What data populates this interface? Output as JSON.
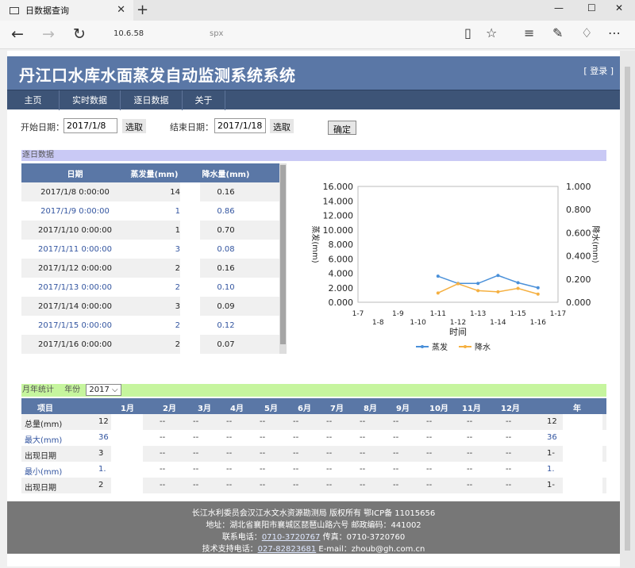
{
  "browser": {
    "tab_title": "日数据查询",
    "url_host": "10.6.58",
    "url_suffix": "spx"
  },
  "header": {
    "title": "丹江口水库水面蒸发自动监测系统系统",
    "login": "[ 登录 ]"
  },
  "menu": [
    "主页",
    "实时数据",
    "逐日数据",
    "关于"
  ],
  "query": {
    "start_label": "开始日期：",
    "start_value": "2017/1/8",
    "end_label": "结束日期：",
    "end_value": "2017/1/18",
    "pick_label": "选取",
    "ok_label": "确定"
  },
  "daily": {
    "section_title": "逐日数据",
    "headers": [
      "日期",
      "蒸发量(mm)",
      "降水量(mm)"
    ],
    "rows": [
      [
        "2017/1/8 0:00:00",
        "14",
        "0.16"
      ],
      [
        "2017/1/9 0:00:00",
        "1",
        "0.86"
      ],
      [
        "2017/1/10 0:00:00",
        "1",
        "0.70"
      ],
      [
        "2017/1/11 0:00:00",
        "3",
        "0.08"
      ],
      [
        "2017/1/12 0:00:00",
        "2",
        "0.16"
      ],
      [
        "2017/1/13 0:00:00",
        "2",
        "0.10"
      ],
      [
        "2017/1/14 0:00:00",
        "3",
        "0.09"
      ],
      [
        "2017/1/15 0:00:00",
        "2",
        "0.12"
      ],
      [
        "2017/1/16 0:00:00",
        "2",
        "0.07"
      ]
    ]
  },
  "chart_data": {
    "type": "line",
    "x_ticks_top": [
      "1-7",
      "1-9",
      "1-11",
      "1-13",
      "1-15",
      "1-17"
    ],
    "x_ticks_bottom": [
      "1-8",
      "1-10",
      "1-12",
      "1-14",
      "1-16"
    ],
    "xlabel": "时间",
    "ylabel_left": "蒸发(mm)",
    "ylabel_right": "降水(mm)",
    "y_left_ticks": [
      "16.000",
      "14.000",
      "12.000",
      "10.000",
      "8.000",
      "6.000",
      "4.000",
      "2.000",
      "0.000"
    ],
    "y_right_ticks": [
      "1.000",
      "0.800",
      "0.600",
      "0.400",
      "0.200",
      "0.000"
    ],
    "ylim_left": [
      0,
      16
    ],
    "ylim_right": [
      0,
      1
    ],
    "series": [
      {
        "name": "蒸发",
        "color": "#4a90d9",
        "x": [
          "1-11",
          "1-12",
          "1-13",
          "1-14",
          "1-15",
          "1-16"
        ],
        "values": [
          3.6,
          2.6,
          2.6,
          3.7,
          2.7,
          2.0
        ]
      },
      {
        "name": "降水",
        "color": "#f5b041",
        "x": [
          "1-11",
          "1-12",
          "1-13",
          "1-14",
          "1-15",
          "1-16"
        ],
        "values": [
          0.08,
          0.16,
          0.1,
          0.09,
          0.12,
          0.07
        ]
      }
    ]
  },
  "monthly": {
    "section_title": "月年统计",
    "year_label": "年份",
    "year_value": "2017",
    "headers": [
      "项目",
      "1月",
      "2月",
      "3月",
      "4月",
      "5月",
      "6月",
      "7月",
      "8月",
      "9月",
      "10月",
      "11月",
      "12月",
      "年"
    ],
    "rows": [
      [
        "总量(mm)",
        "12",
        "--",
        "--",
        "--",
        "--",
        "--",
        "--",
        "--",
        "--",
        "--",
        "--",
        "--",
        "12"
      ],
      [
        "最大(mm)",
        "36",
        "--",
        "--",
        "--",
        "--",
        "--",
        "--",
        "--",
        "--",
        "--",
        "--",
        "--",
        "36"
      ],
      [
        "出现日期",
        "3",
        "--",
        "--",
        "--",
        "--",
        "--",
        "--",
        "--",
        "--",
        "--",
        "--",
        "--",
        "1-"
      ],
      [
        "最小(mm)",
        "1.",
        "--",
        "--",
        "--",
        "--",
        "--",
        "--",
        "--",
        "--",
        "--",
        "--",
        "--",
        "1."
      ],
      [
        "出现日期",
        "2",
        "--",
        "--",
        "--",
        "--",
        "--",
        "--",
        "--",
        "--",
        "--",
        "--",
        "--",
        "1-"
      ]
    ]
  },
  "footer": {
    "line1": "长江水利委员会汉江水文水资源勘测局 版权所有 鄂ICP备 11015656",
    "line2": "地址：湖北省襄阳市襄城区琵琶山路六号 邮政编码：441002",
    "phone_label": "联系电话：",
    "phone": "0710-3720767",
    "fax_label": " 传真：",
    "fax": "0710-3720760",
    "support_label": "技术支持电话：",
    "support_phone": "027-82823681",
    "email_label": " E-mail：",
    "email": "zhoub@gh.com.cn"
  }
}
